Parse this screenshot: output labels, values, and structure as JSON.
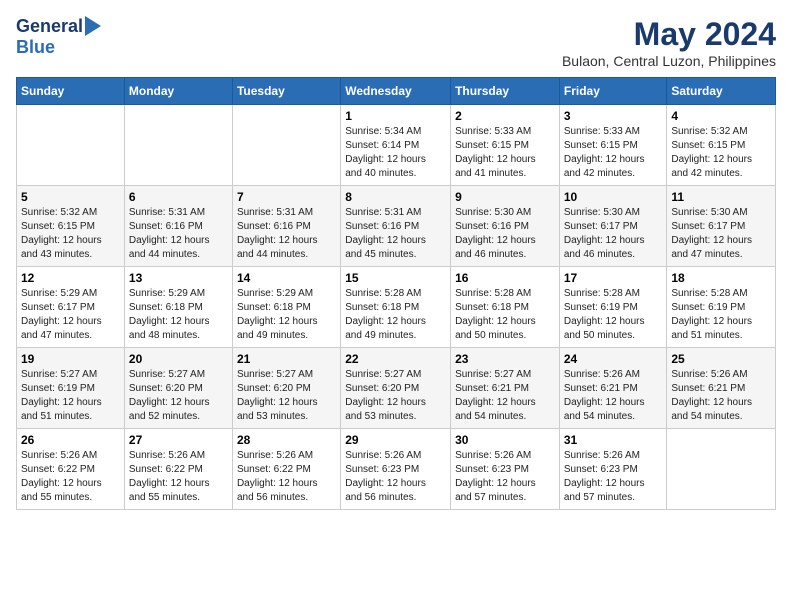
{
  "header": {
    "logo_line1": "General",
    "logo_line2": "Blue",
    "month_year": "May 2024",
    "location": "Bulaon, Central Luzon, Philippines"
  },
  "weekdays": [
    "Sunday",
    "Monday",
    "Tuesday",
    "Wednesday",
    "Thursday",
    "Friday",
    "Saturday"
  ],
  "weeks": [
    [
      {
        "day": "",
        "info": ""
      },
      {
        "day": "",
        "info": ""
      },
      {
        "day": "",
        "info": ""
      },
      {
        "day": "1",
        "info": "Sunrise: 5:34 AM\nSunset: 6:14 PM\nDaylight: 12 hours\nand 40 minutes."
      },
      {
        "day": "2",
        "info": "Sunrise: 5:33 AM\nSunset: 6:15 PM\nDaylight: 12 hours\nand 41 minutes."
      },
      {
        "day": "3",
        "info": "Sunrise: 5:33 AM\nSunset: 6:15 PM\nDaylight: 12 hours\nand 42 minutes."
      },
      {
        "day": "4",
        "info": "Sunrise: 5:32 AM\nSunset: 6:15 PM\nDaylight: 12 hours\nand 42 minutes."
      }
    ],
    [
      {
        "day": "5",
        "info": "Sunrise: 5:32 AM\nSunset: 6:15 PM\nDaylight: 12 hours\nand 43 minutes."
      },
      {
        "day": "6",
        "info": "Sunrise: 5:31 AM\nSunset: 6:16 PM\nDaylight: 12 hours\nand 44 minutes."
      },
      {
        "day": "7",
        "info": "Sunrise: 5:31 AM\nSunset: 6:16 PM\nDaylight: 12 hours\nand 44 minutes."
      },
      {
        "day": "8",
        "info": "Sunrise: 5:31 AM\nSunset: 6:16 PM\nDaylight: 12 hours\nand 45 minutes."
      },
      {
        "day": "9",
        "info": "Sunrise: 5:30 AM\nSunset: 6:16 PM\nDaylight: 12 hours\nand 46 minutes."
      },
      {
        "day": "10",
        "info": "Sunrise: 5:30 AM\nSunset: 6:17 PM\nDaylight: 12 hours\nand 46 minutes."
      },
      {
        "day": "11",
        "info": "Sunrise: 5:30 AM\nSunset: 6:17 PM\nDaylight: 12 hours\nand 47 minutes."
      }
    ],
    [
      {
        "day": "12",
        "info": "Sunrise: 5:29 AM\nSunset: 6:17 PM\nDaylight: 12 hours\nand 47 minutes."
      },
      {
        "day": "13",
        "info": "Sunrise: 5:29 AM\nSunset: 6:18 PM\nDaylight: 12 hours\nand 48 minutes."
      },
      {
        "day": "14",
        "info": "Sunrise: 5:29 AM\nSunset: 6:18 PM\nDaylight: 12 hours\nand 49 minutes."
      },
      {
        "day": "15",
        "info": "Sunrise: 5:28 AM\nSunset: 6:18 PM\nDaylight: 12 hours\nand 49 minutes."
      },
      {
        "day": "16",
        "info": "Sunrise: 5:28 AM\nSunset: 6:18 PM\nDaylight: 12 hours\nand 50 minutes."
      },
      {
        "day": "17",
        "info": "Sunrise: 5:28 AM\nSunset: 6:19 PM\nDaylight: 12 hours\nand 50 minutes."
      },
      {
        "day": "18",
        "info": "Sunrise: 5:28 AM\nSunset: 6:19 PM\nDaylight: 12 hours\nand 51 minutes."
      }
    ],
    [
      {
        "day": "19",
        "info": "Sunrise: 5:27 AM\nSunset: 6:19 PM\nDaylight: 12 hours\nand 51 minutes."
      },
      {
        "day": "20",
        "info": "Sunrise: 5:27 AM\nSunset: 6:20 PM\nDaylight: 12 hours\nand 52 minutes."
      },
      {
        "day": "21",
        "info": "Sunrise: 5:27 AM\nSunset: 6:20 PM\nDaylight: 12 hours\nand 53 minutes."
      },
      {
        "day": "22",
        "info": "Sunrise: 5:27 AM\nSunset: 6:20 PM\nDaylight: 12 hours\nand 53 minutes."
      },
      {
        "day": "23",
        "info": "Sunrise: 5:27 AM\nSunset: 6:21 PM\nDaylight: 12 hours\nand 54 minutes."
      },
      {
        "day": "24",
        "info": "Sunrise: 5:26 AM\nSunset: 6:21 PM\nDaylight: 12 hours\nand 54 minutes."
      },
      {
        "day": "25",
        "info": "Sunrise: 5:26 AM\nSunset: 6:21 PM\nDaylight: 12 hours\nand 54 minutes."
      }
    ],
    [
      {
        "day": "26",
        "info": "Sunrise: 5:26 AM\nSunset: 6:22 PM\nDaylight: 12 hours\nand 55 minutes."
      },
      {
        "day": "27",
        "info": "Sunrise: 5:26 AM\nSunset: 6:22 PM\nDaylight: 12 hours\nand 55 minutes."
      },
      {
        "day": "28",
        "info": "Sunrise: 5:26 AM\nSunset: 6:22 PM\nDaylight: 12 hours\nand 56 minutes."
      },
      {
        "day": "29",
        "info": "Sunrise: 5:26 AM\nSunset: 6:23 PM\nDaylight: 12 hours\nand 56 minutes."
      },
      {
        "day": "30",
        "info": "Sunrise: 5:26 AM\nSunset: 6:23 PM\nDaylight: 12 hours\nand 57 minutes."
      },
      {
        "day": "31",
        "info": "Sunrise: 5:26 AM\nSunset: 6:23 PM\nDaylight: 12 hours\nand 57 minutes."
      },
      {
        "day": "",
        "info": ""
      }
    ]
  ]
}
